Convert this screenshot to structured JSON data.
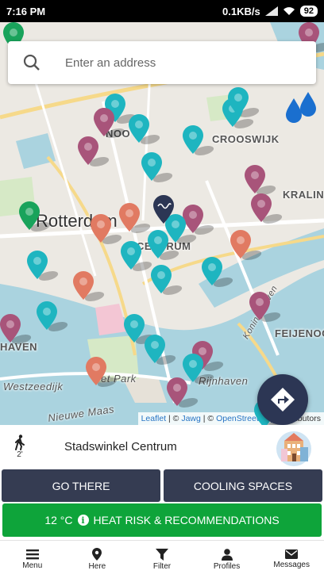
{
  "status_bar": {
    "time": "7:16 PM",
    "network_speed": "0.1KB/s",
    "battery": "92"
  },
  "search": {
    "placeholder": "Enter an address",
    "icon": "search-icon"
  },
  "map": {
    "labels": {
      "city": "Rotterdam",
      "noord": "NOO",
      "crooswijk": "CROOSWIJK",
      "kralingen": "KRALIN",
      "centrum": "CENTRUM",
      "feijenoord": "FEIJENOO",
      "delfshaven": "HAVEN",
      "rijnhaven": "Rijnhaven",
      "westzeedijk": "Westzeedijk",
      "nieuwe_maas": "Nieuwe Maas",
      "het_park": "et Park",
      "koningshaven": "Koningshaven"
    },
    "attribution": {
      "leaflet": "Leaflet",
      "sep1": " | © ",
      "jawg": "Jawg",
      "sep2": " | © ",
      "osm": "OpenStreetMap",
      "suffix": " contributors"
    },
    "colors": {
      "teal": "#1eb5c0",
      "mauve": "#a8547a",
      "salmon": "#e17a62",
      "green": "#19a35b",
      "navy": "#2c3654",
      "water": "#aad3df",
      "road": "#f6d98a"
    }
  },
  "selected_place": {
    "walk_icon": "walking-person-icon",
    "walk_value": "2'",
    "name": "Stadswinkel Centrum"
  },
  "actions": {
    "go_there": "GO THERE",
    "cooling_spaces": "COOLING SPACES"
  },
  "heat": {
    "temperature": "12 °C",
    "label": "HEAT RISK & RECOMMENDATIONS"
  },
  "bottom_nav": [
    {
      "label": "Menu",
      "icon": "menu-icon"
    },
    {
      "label": "Here",
      "icon": "location-pin-icon"
    },
    {
      "label": "Filter",
      "icon": "filter-icon"
    },
    {
      "label": "Profiles",
      "icon": "person-icon"
    },
    {
      "label": "Messages",
      "icon": "envelope-icon"
    }
  ]
}
